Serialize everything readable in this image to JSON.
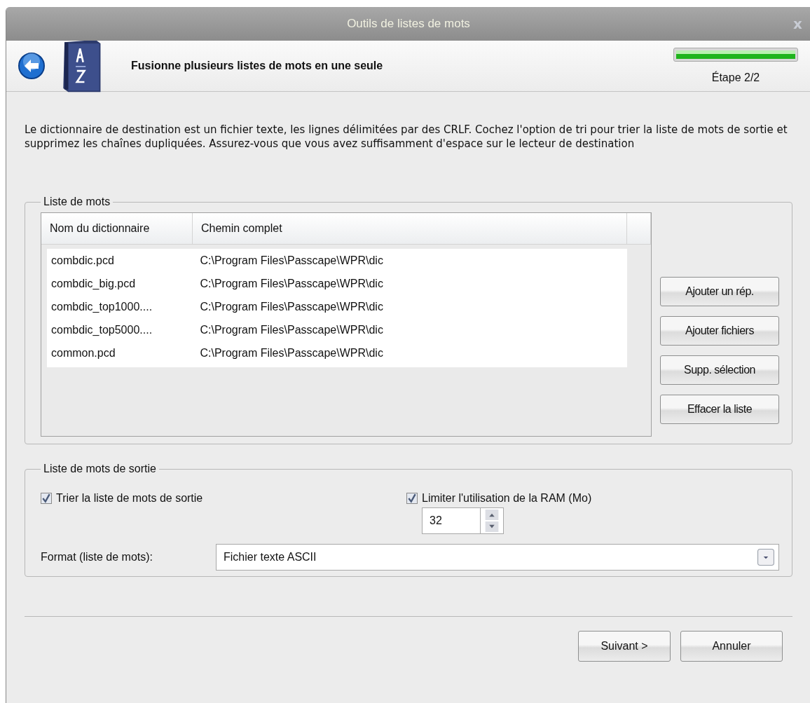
{
  "window": {
    "title": "Outils de listes de mots",
    "close": "x"
  },
  "header": {
    "title": "Fusionne plusieurs listes de mots en une seule",
    "progress": {
      "level": 1.0
    },
    "step": "Étape 2/2"
  },
  "description": "Le dictionnaire de destination est un fichier texte, les lignes délimitées par des CRLF. Cochez l'option de tri pour trier la liste de mots de sortie et supprimez les chaînes dupliquées. Assurez-vous que vous avez suffisamment d'espace sur le lecteur de destination",
  "wordlist": {
    "legend": "Liste de mots",
    "columns": [
      "Nom du dictionnaire",
      "Chemin complet"
    ],
    "rows": [
      {
        "name": "combdic.pcd",
        "path": "C:\\Program Files\\Passcape\\WPR\\dic"
      },
      {
        "name": "combdic_big.pcd",
        "path": "C:\\Program Files\\Passcape\\WPR\\dic"
      },
      {
        "name": "combdic_top1000....",
        "path": "C:\\Program Files\\Passcape\\WPR\\dic"
      },
      {
        "name": "combdic_top5000....",
        "path": "C:\\Program Files\\Passcape\\WPR\\dic"
      },
      {
        "name": "common.pcd",
        "path": "C:\\Program Files\\Passcape\\WPR\\dic"
      }
    ],
    "buttons": [
      "Ajouter un rép.",
      "Ajouter fichiers",
      "Supp. sélection",
      "Effacer la liste"
    ]
  },
  "output": {
    "legend": "Liste de mots de sortie",
    "sort": {
      "label": "Trier la liste de mots de sortie",
      "checked": true
    },
    "limit_ram": {
      "label": "Limiter l'utilisation de la RAM (Mo)",
      "checked": true,
      "value": "32"
    },
    "format": {
      "label": "Format (liste de mots):",
      "value": "Fichier texte ASCII"
    }
  },
  "buttons": [
    "Suivant >",
    "Annuler"
  ]
}
